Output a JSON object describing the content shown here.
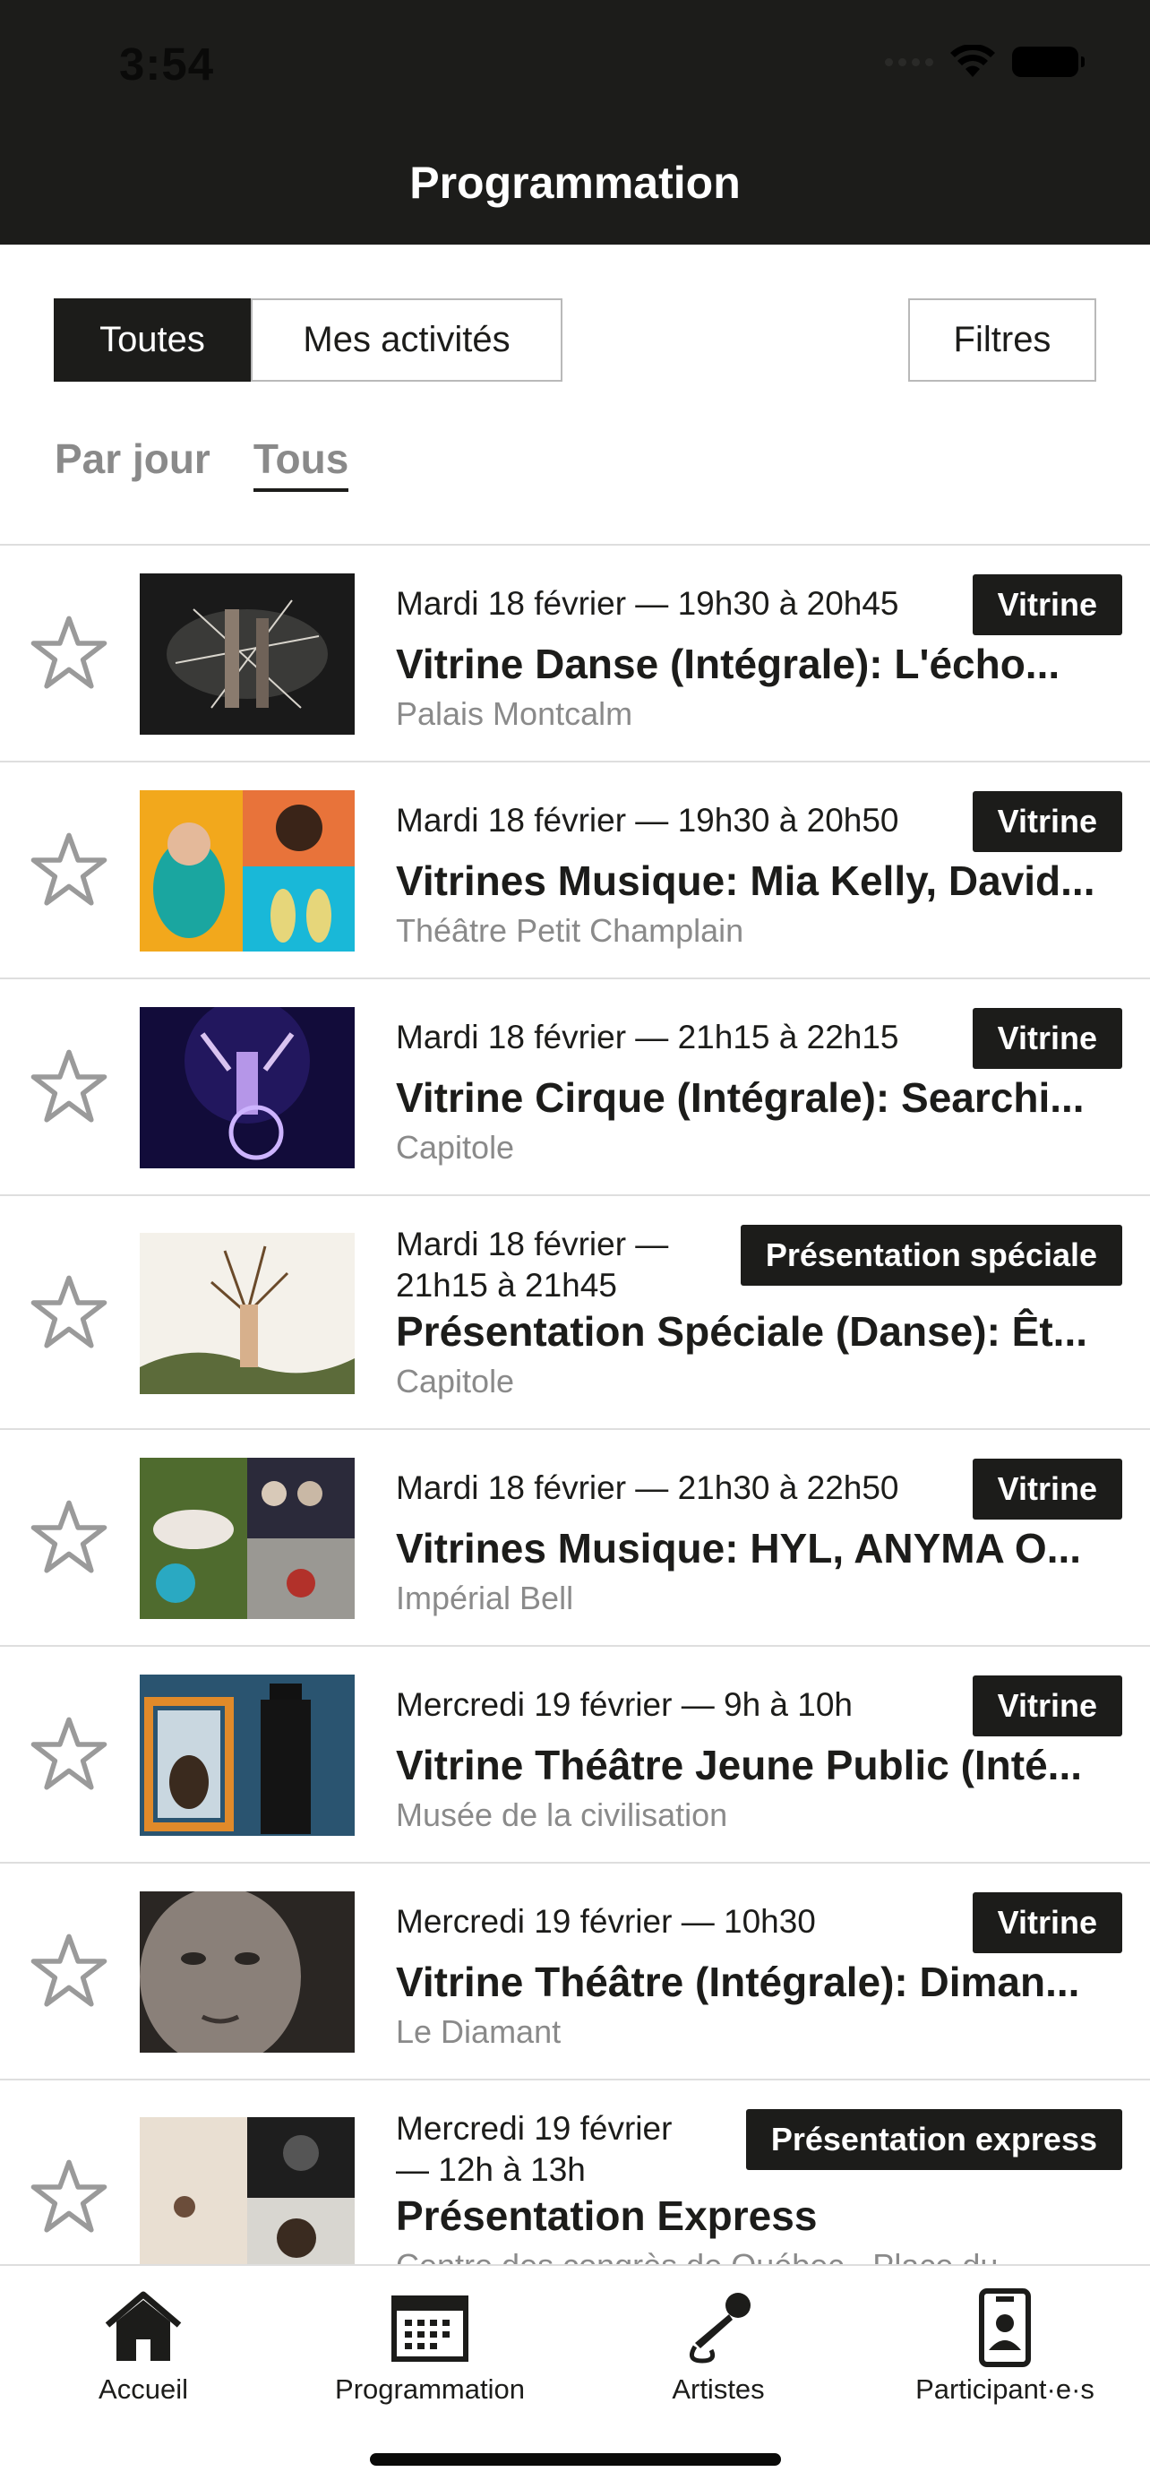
{
  "status_bar": {
    "time": "3:54"
  },
  "header": {
    "title": "Programmation"
  },
  "segmented": {
    "all_label": "Toutes",
    "mine_label": "Mes activités"
  },
  "filters_label": "Filtres",
  "day_tabs": {
    "by_day": "Par jour",
    "all": "Tous"
  },
  "events": [
    {
      "when": "Mardi 18 février — 19h30 à 20h45",
      "title": "Vitrine Danse (Intégrale): L'écho...",
      "venue": "Palais Montcalm",
      "tag": "Vitrine"
    },
    {
      "when": "Mardi 18 février — 19h30 à 20h50",
      "title": "Vitrines Musique: Mia Kelly, David...",
      "venue": "Théâtre Petit Champlain",
      "tag": "Vitrine"
    },
    {
      "when": "Mardi 18 février — 21h15 à 22h15",
      "title": "Vitrine Cirque (Intégrale): Searchi...",
      "venue": "Capitole",
      "tag": "Vitrine"
    },
    {
      "when_line1": "Mardi 18 février —",
      "when_line2": "21h15 à 21h45",
      "title": "Présentation Spéciale (Danse): Êt...",
      "venue": "Capitole",
      "tag": "Présentation spéciale"
    },
    {
      "when": "Mardi 18 février — 21h30 à 22h50",
      "title": "Vitrines Musique: HYL, ANYMA O...",
      "venue": "Impérial Bell",
      "tag": "Vitrine"
    },
    {
      "when": "Mercredi 19 février — 9h à 10h",
      "title": "Vitrine Théâtre Jeune Public (Inté...",
      "venue": "Musée de la civilisation",
      "tag": "Vitrine"
    },
    {
      "when": "Mercredi 19 février — 10h30",
      "title": "Vitrine Théâtre (Intégrale): Diman...",
      "venue": "Le Diamant",
      "tag": "Vitrine"
    },
    {
      "when_line1": "Mercredi 19 février",
      "when_line2": "— 12h à 13h",
      "title": "Présentation Express",
      "venue": "Centre des congrès de Québec - Place du...",
      "tag": "Présentation express"
    }
  ],
  "tabbar": {
    "home": "Accueil",
    "program": "Programmation",
    "artists": "Artistes",
    "participants": "Participant·e·s"
  },
  "colors": {
    "dark": "#1c1c1a",
    "muted": "#8a8a8a",
    "divider": "#dedede"
  }
}
